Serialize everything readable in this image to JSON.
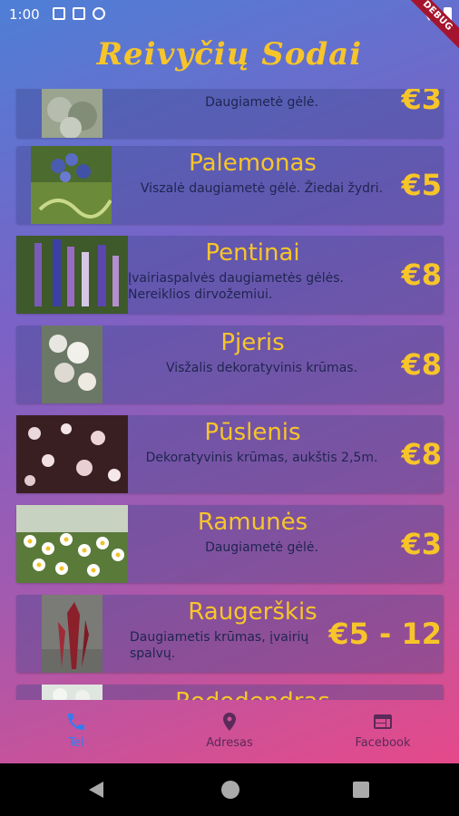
{
  "status": {
    "time": "1:00"
  },
  "debug_label": "DEBUG",
  "app": {
    "title": "Reivyčių Sodai"
  },
  "plants": [
    {
      "name": "",
      "desc": "Daugiametė gėlė.",
      "price": "€3"
    },
    {
      "name": "Palemonas",
      "desc": "Viszalė daugiametė gėlė. Žiedai žydri.",
      "price": "€5"
    },
    {
      "name": "Pentinai",
      "desc": "Įvairiaspalvės daugiametės gėlės. Nereiklios dirvožemiui.",
      "price": "€8"
    },
    {
      "name": "Pjeris",
      "desc": "Visžalis dekoratyvinis krūmas.",
      "price": "€8"
    },
    {
      "name": "Pūslenis",
      "desc": "Dekoratyvinis krūmas, aukštis 2,5m.",
      "price": "€8"
    },
    {
      "name": "Ramunės",
      "desc": "Daugiametė gėlė.",
      "price": "€3"
    },
    {
      "name": "Raugerškis",
      "desc": "Daugiametis krūmas, įvairių spalvų.",
      "price": "€5 - 12"
    },
    {
      "name": "Rododendras",
      "desc": "",
      "price": ""
    }
  ],
  "nav": {
    "tel": "Tel",
    "adresas": "Adresas",
    "facebook": "Facebook"
  },
  "colors": {
    "accent": "#f7c52a",
    "active_nav": "#2f7ef2"
  }
}
